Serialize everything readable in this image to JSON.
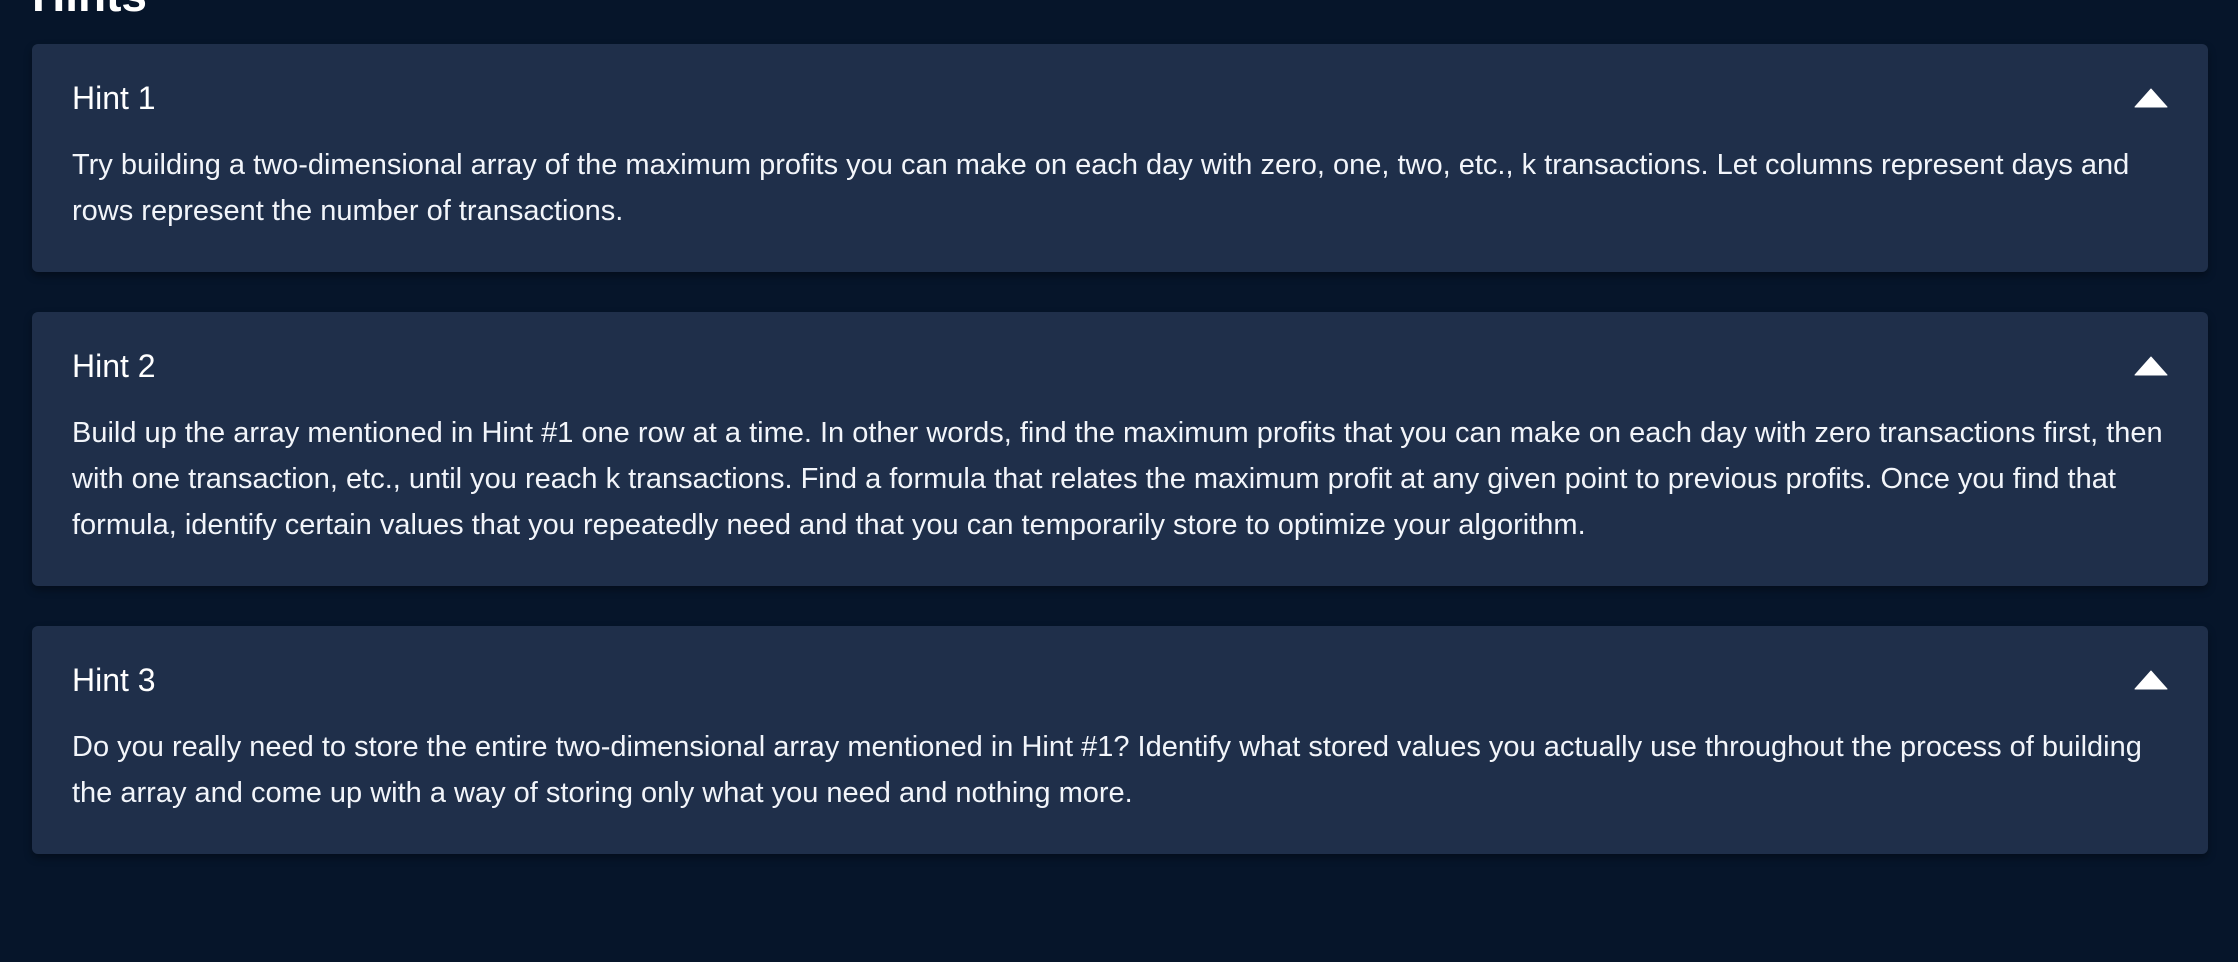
{
  "section": {
    "title": "Hints"
  },
  "hints": [
    {
      "title": "Hint 1",
      "body": "Try building a two-dimensional array of the maximum profits you can make on each day with zero, one, two, etc., k transactions. Let columns represent days and rows represent the number of transactions.",
      "expanded_icon": "chevron-up-icon"
    },
    {
      "title": "Hint 2",
      "body": "Build up the array mentioned in Hint #1 one row at a time. In other words, find the maximum profits that you can make on each day with zero transactions first, then with one transaction, etc., until you reach k transactions. Find a formula that relates the maximum profit at any given point to previous profits. Once you find that formula, identify certain values that you repeatedly need and that you can temporarily store to optimize your algorithm.",
      "expanded_icon": "chevron-up-icon"
    },
    {
      "title": "Hint 3",
      "body": "Do you really need to store the entire two-dimensional array mentioned in Hint #1? Identify what stored values you actually use throughout the process of building the array and come up with a way of storing only what you need and nothing more.",
      "expanded_icon": "chevron-up-icon"
    }
  ],
  "colors": {
    "background": "#06152a",
    "card": "#1f2f4a",
    "text": "#ffffff"
  }
}
